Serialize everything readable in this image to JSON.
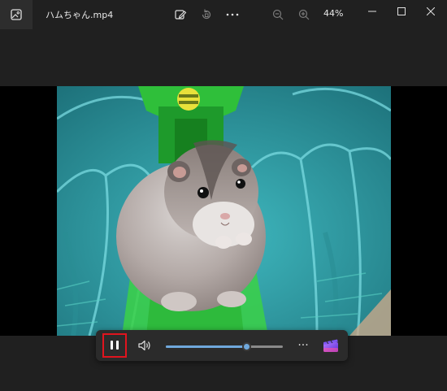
{
  "window": {
    "title": "ハムちゃん.mp4",
    "zoom_level": "44%"
  },
  "toolbar": {
    "icons": [
      "photos-app-icon",
      "edit-icon",
      "rotate-icon",
      "more-icon",
      "zoom-out-icon",
      "zoom-in-icon"
    ]
  },
  "window_controls": [
    "minimize-icon",
    "maximize-icon",
    "close-icon"
  ],
  "player": {
    "state": "playing",
    "seek_progress": 0.69,
    "more_label": "···",
    "icons": [
      "pause-icon",
      "volume-icon",
      "more-icon",
      "clipchamp-icon"
    ]
  },
  "colors": {
    "accent": "#6fa8dc",
    "highlight_border": "#e0141e",
    "background": "#202020"
  }
}
